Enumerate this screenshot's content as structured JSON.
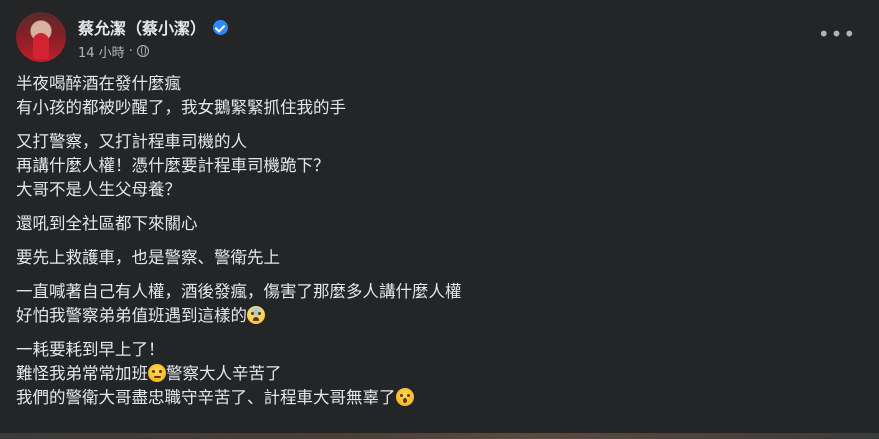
{
  "post": {
    "author": "蔡允潔（蔡小潔）",
    "time": "14 小時",
    "separator": "·",
    "more_icon": "more-horizontal-icon",
    "verified_icon": "verified-badge-icon",
    "privacy_icon": "globe-icon"
  },
  "body": {
    "p1_l1": "半夜喝醉酒在發什麼瘋",
    "p1_l2": "有小孩的都被吵醒了，我女鵝緊緊抓住我的手",
    "p2_l1": "又打警察，又打計程車司機的人",
    "p2_l2": "再講什麼人權！憑什麼要計程車司機跪下？",
    "p2_l3": "大哥不是人生父母養？",
    "p3_l1": "還吼到全社區都下來關心",
    "p4_l1": "要先上救護車，也是警察、警衛先上",
    "p5_l1": "一直喊著自己有人權，酒後發瘋，傷害了那麼多人講什麼人權",
    "p5_l2": "好怕我警察弟弟值班遇到這樣的",
    "p6_l1": "一耗要耗到早上了！",
    "p6_l2a": "難怪我弟常常加班",
    "p6_l2b": "警察大人辛苦了",
    "p6_l3": "我們的警衛大哥盡忠職守辛苦了、計程車大哥無辜了"
  },
  "emojis": {
    "e1": "fearful-face-emoji",
    "e2": "pleading-face-emoji",
    "e3": "astonished-face-emoji"
  },
  "colors": {
    "background": "#242526",
    "text": "#e4e6eb",
    "secondary_text": "#b0b3b8",
    "verified": "#2d88ff"
  }
}
